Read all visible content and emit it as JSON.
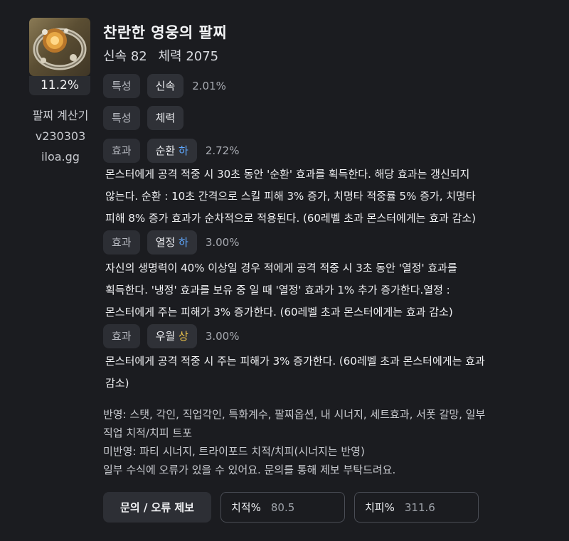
{
  "item": {
    "icon": "bracelet-icon",
    "percentage": "11.2%",
    "title": "찬란한 영웅의 팔찌",
    "stats": [
      "신속 82",
      "체력 2075"
    ]
  },
  "calculator": {
    "name": "팔찌 계산기",
    "version": "v230303",
    "site": "iloa.gg"
  },
  "rows": [
    {
      "tag": "특성",
      "name": "신속",
      "grade": "",
      "value": "2.01%"
    },
    {
      "tag": "특성",
      "name": "체력",
      "grade": "",
      "value": ""
    },
    {
      "tag": "효과",
      "name": "순환",
      "grade": "하",
      "value": "2.72%",
      "description": [
        "몬스터에게 공격 적중 시 30초 동안 '순환' 효과를 획득한다. 해당 효과는 갱신되지",
        "않는다. 순환 : 10초 간격으로 스킬 피해 3% 증가, 치명타 적중률 5% 증가, 치명타",
        "피해 8% 증가 효과가 순차적으로 적용된다. (60레벨 초과 몬스터에게는 효과 감소)"
      ]
    },
    {
      "tag": "효과",
      "name": "열정",
      "grade": "하",
      "value": "3.00%",
      "description": [
        "자신의 생명력이 40% 이상일 경우 적에게 공격 적중 시 3초 동안 '열정' 효과를",
        "획득한다. '냉정' 효과를 보유 중 일 때 '열정' 효과가 1% 추가 증가한다.열정 :",
        "몬스터에게 주는 피해가 3% 증가한다. (60레벨 초과 몬스터에게는 효과 감소)"
      ]
    },
    {
      "tag": "효과",
      "name": "우월",
      "grade": "상",
      "value": "3.00%",
      "description": [
        "몬스터에게 공격 적중 시 주는 피해가 3% 증가한다. (60레벨 초과 몬스터에게는 효과",
        "감소)"
      ]
    }
  ],
  "notes": [
    "반영: 스탯, 각인, 직업각인, 특화계수, 팔찌옵션, 내 시너지, 세트효과, 서폿 갈망, 일부",
    "직업 치적/치피 트포",
    "미반영: 파티 시너지, 트라이포드 치적/치피(시너지는 반영)",
    "일부 수식에 오류가 있을 수 있어요. 문의를 통해 제보 부탁드려요."
  ],
  "footer": {
    "report_button": "문의 / 오류 제보",
    "crit_rate_label": "치적%",
    "crit_rate_value": "80.5",
    "crit_dmg_label": "치피%",
    "crit_dmg_value": "311.6"
  },
  "colors": {
    "background": "#1b1c20",
    "grade_low": "#5fa8ff",
    "grade_high": "#f0c64a"
  }
}
